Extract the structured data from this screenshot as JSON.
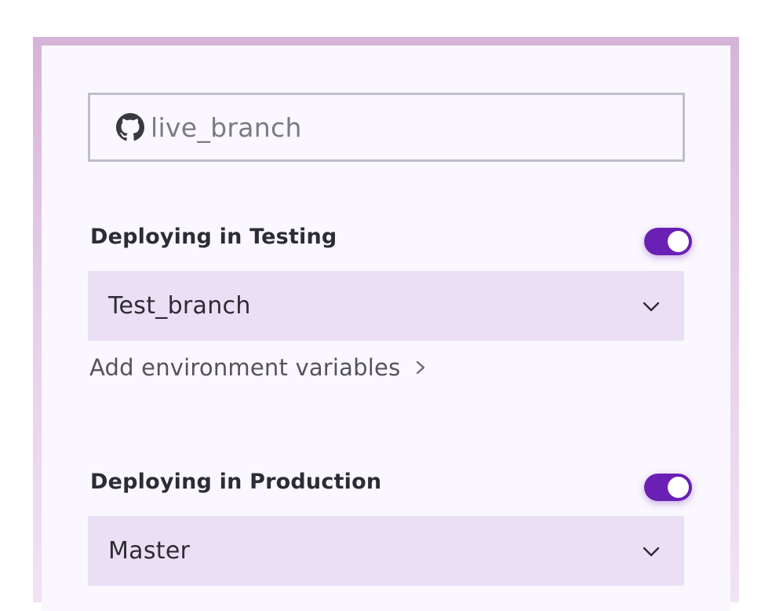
{
  "repository": {
    "icon": "github-icon",
    "branch": "live_branch"
  },
  "testing": {
    "label": "Deploying in Testing",
    "enabled": true,
    "selected_branch": "Test_branch",
    "env_link_label": "Add environment variables"
  },
  "production": {
    "label": "Deploying in Production",
    "enabled": true,
    "selected_branch": "Master"
  },
  "colors": {
    "accent": "#6a20b4",
    "select_background": "#eadff5",
    "frame_border": "#d6b3d8"
  }
}
